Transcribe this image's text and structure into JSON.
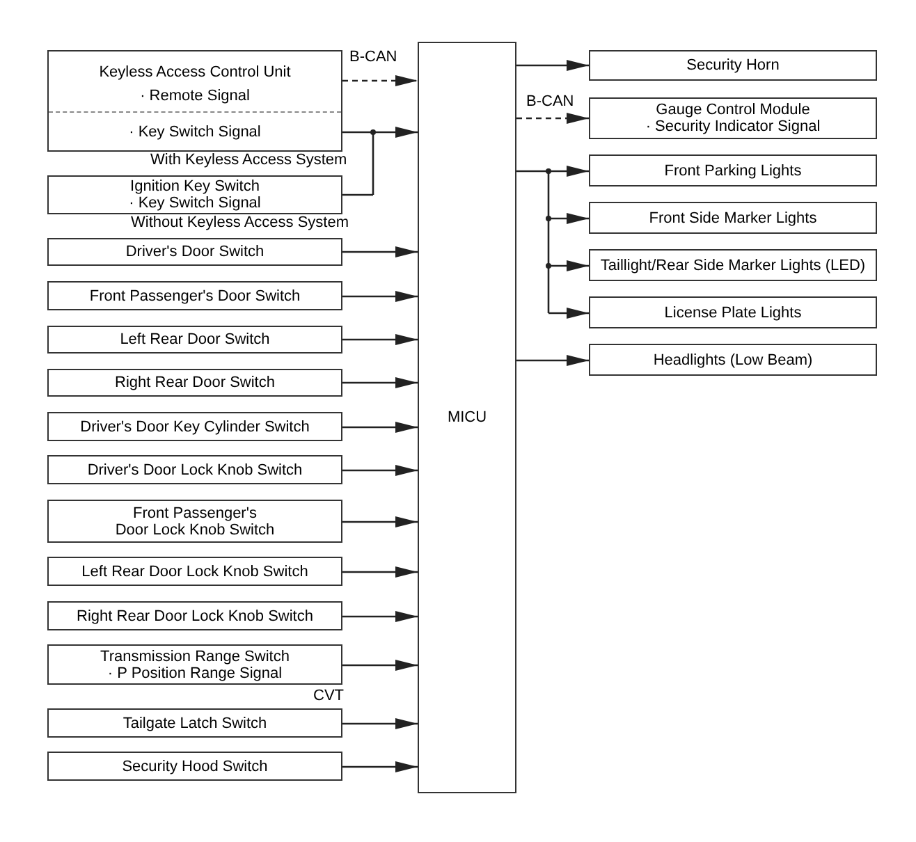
{
  "control_unit": {
    "title": "Keyless Access Control Unit",
    "signals": [
      "· Remote Signal",
      "· Key Switch Signal"
    ],
    "bus_label": "B-CAN",
    "note": "With Keyless Access System"
  },
  "ignition_switch": {
    "title": "Ignition Key Switch",
    "signal": "· Key Switch Signal",
    "note": "Without Keyless Access System"
  },
  "inputs": [
    {
      "lines": [
        "Driver's Door Switch"
      ]
    },
    {
      "lines": [
        "Front Passenger's Door Switch"
      ]
    },
    {
      "lines": [
        "Left Rear Door Switch"
      ]
    },
    {
      "lines": [
        "Right Rear Door Switch"
      ]
    },
    {
      "lines": [
        "Driver's Door Key Cylinder Switch"
      ]
    },
    {
      "lines": [
        "Driver's Door Lock Knob Switch"
      ]
    },
    {
      "lines": [
        "Front Passenger's",
        "Door Lock Knob Switch"
      ]
    },
    {
      "lines": [
        "Left Rear Door Lock Knob Switch"
      ]
    },
    {
      "lines": [
        "Right Rear Door Lock Knob Switch"
      ]
    },
    {
      "lines": [
        "Transmission Range Switch"
      ],
      "signal": "· P Position Range Signal",
      "note": "CVT"
    },
    {
      "lines": [
        "Tailgate Latch Switch"
      ]
    },
    {
      "lines": [
        "Security Hood Switch"
      ]
    }
  ],
  "micu": {
    "label": "MICU"
  },
  "outputs": [
    {
      "kind": "direct",
      "title": "Security Horn"
    },
    {
      "kind": "bus",
      "title": "Gauge Control Module",
      "signal": "· Security Indicator Signal",
      "bus_label": "B-CAN"
    },
    {
      "kind": "branch",
      "title": "Front Parking Lights"
    },
    {
      "kind": "branch",
      "title": "Front Side Marker Lights"
    },
    {
      "kind": "branch",
      "title": "Taillight/Rear Side Marker Lights (LED)"
    },
    {
      "kind": "branch",
      "title": "License Plate Lights"
    },
    {
      "kind": "direct",
      "title": "Headlights (Low Beam)"
    }
  ]
}
